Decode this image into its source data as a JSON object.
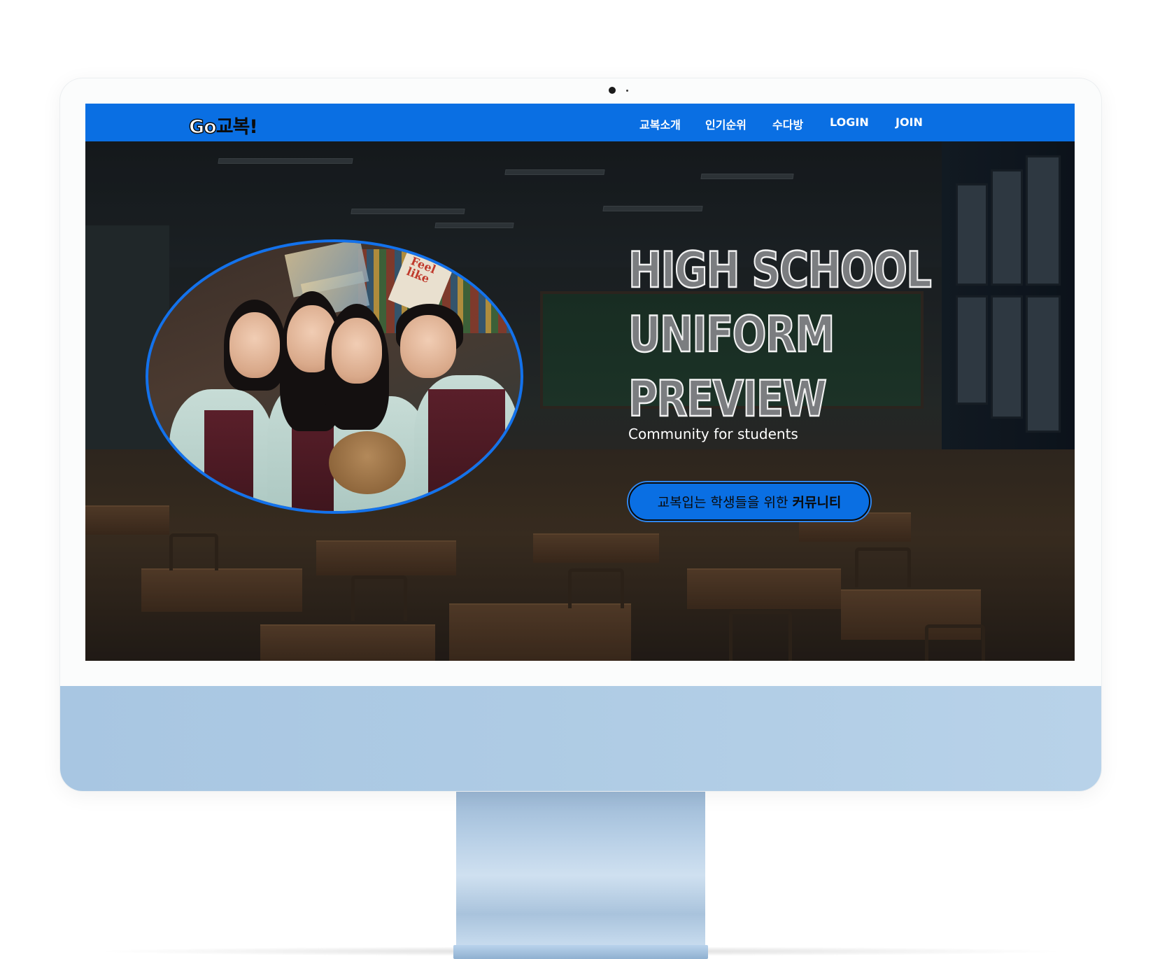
{
  "brand": {
    "logo_go": "Go",
    "logo_rest": "교복!",
    "accent_color": "#0a6fe3"
  },
  "nav": {
    "items": [
      {
        "label": "교복소개"
      },
      {
        "label": "인기순위"
      },
      {
        "label": "수다방"
      },
      {
        "label": "LOGIN"
      },
      {
        "label": "JOIN"
      }
    ]
  },
  "hero": {
    "title_lines": [
      "HIGH SCHOOL",
      "UNIFORM",
      "PREVIEW"
    ],
    "subtitle": "Community for students",
    "cta": {
      "text": "교복입는 학생들을 위한",
      "emphasis": "커뮤니티"
    },
    "photo_sign_text": "Feel like"
  },
  "device": {
    "frame_color": "#fbfcfc",
    "chin_color": "#aecbe4"
  }
}
